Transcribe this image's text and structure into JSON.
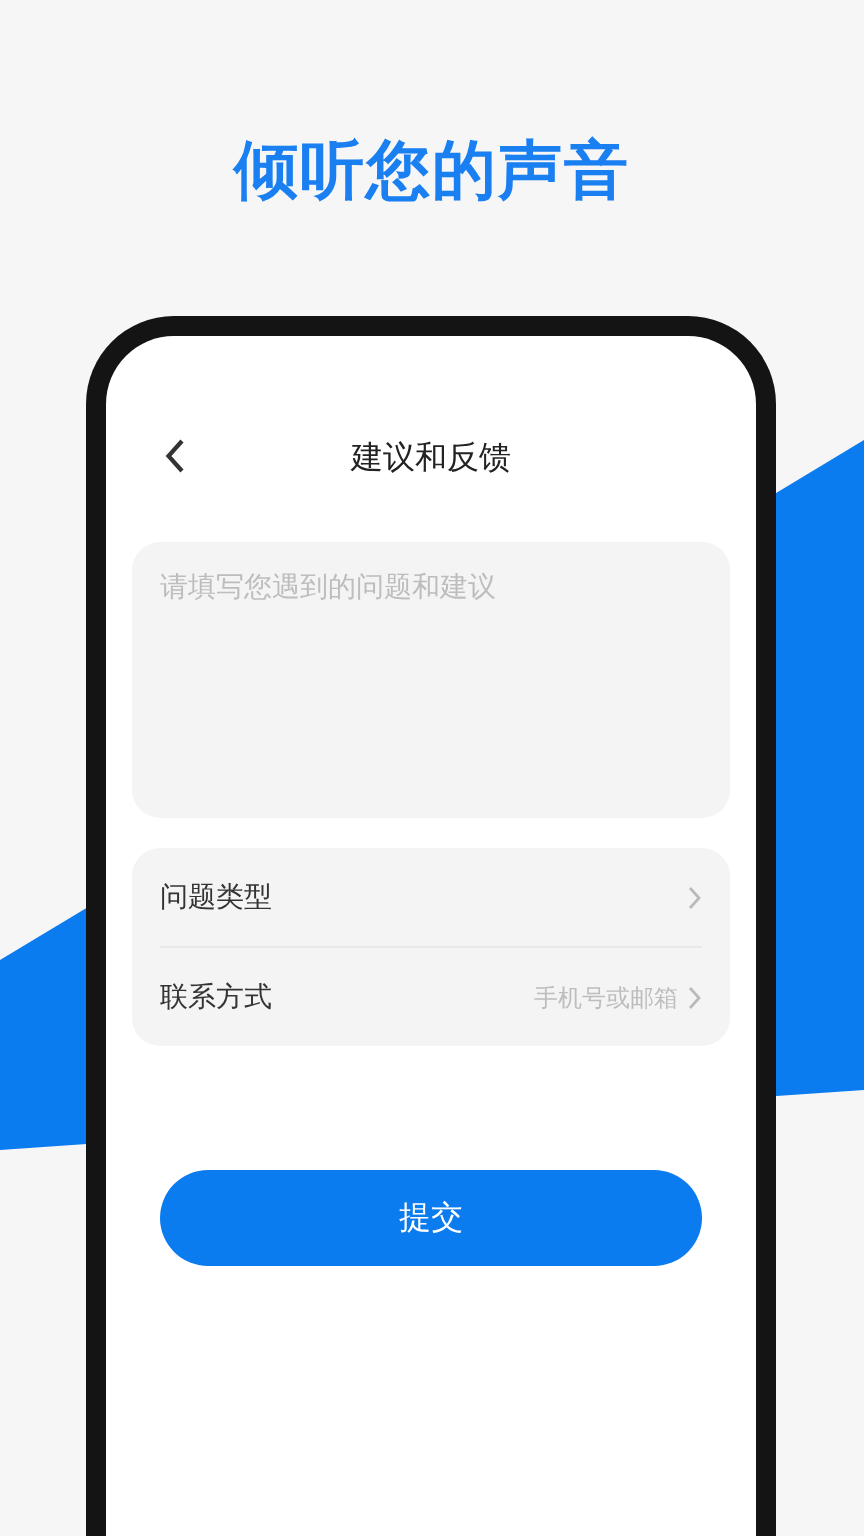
{
  "headline": "倾听您的声音",
  "nav": {
    "title": "建议和反馈"
  },
  "feedback": {
    "placeholder": "请填写您遇到的问题和建议"
  },
  "options": [
    {
      "label": "问题类型"
    },
    {
      "label": "联系方式",
      "placeholder": "手机号或邮箱"
    }
  ],
  "submit": {
    "label": "提交"
  }
}
